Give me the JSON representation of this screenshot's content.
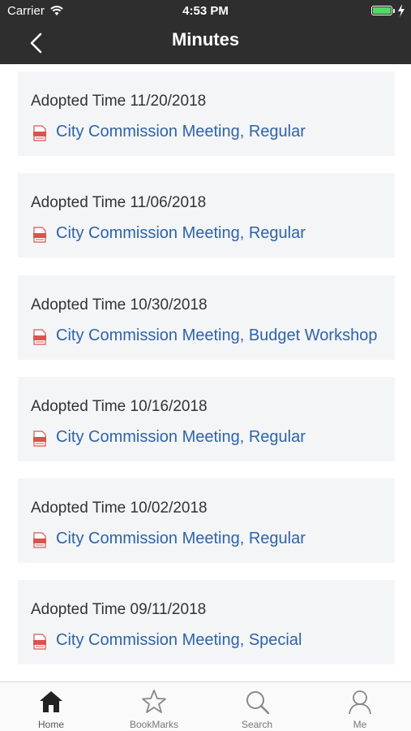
{
  "status_bar": {
    "carrier": "Carrier",
    "time": "4:53 PM"
  },
  "nav": {
    "title": "Minutes",
    "back_icon": "chevron-left-icon"
  },
  "minutes": [
    {
      "adopted": "Adopted Time 11/20/2018",
      "title": "City Commission Meeting, Regular"
    },
    {
      "adopted": "Adopted Time 11/06/2018",
      "title": "City Commission Meeting, Regular"
    },
    {
      "adopted": "Adopted Time 10/30/2018",
      "title": "City Commission Meeting, Budget Workshop"
    },
    {
      "adopted": "Adopted Time 10/16/2018",
      "title": "City Commission Meeting, Regular"
    },
    {
      "adopted": "Adopted Time 10/02/2018",
      "title": "City Commission Meeting, Regular"
    },
    {
      "adopted": "Adopted Time 09/11/2018",
      "title": "City Commission Meeting, Special"
    }
  ],
  "tabs": [
    {
      "label": "Home",
      "icon": "home-icon",
      "active": true
    },
    {
      "label": "BookMarks",
      "icon": "star-icon",
      "active": false
    },
    {
      "label": "Search",
      "icon": "search-icon",
      "active": false
    },
    {
      "label": "Me",
      "icon": "person-icon",
      "active": false
    }
  ],
  "colors": {
    "header": "#2e2e2e",
    "link": "#2f63a8",
    "card": "#f3f5f7",
    "pdf_icon": "#d9534f",
    "battery": "#4cd964"
  }
}
